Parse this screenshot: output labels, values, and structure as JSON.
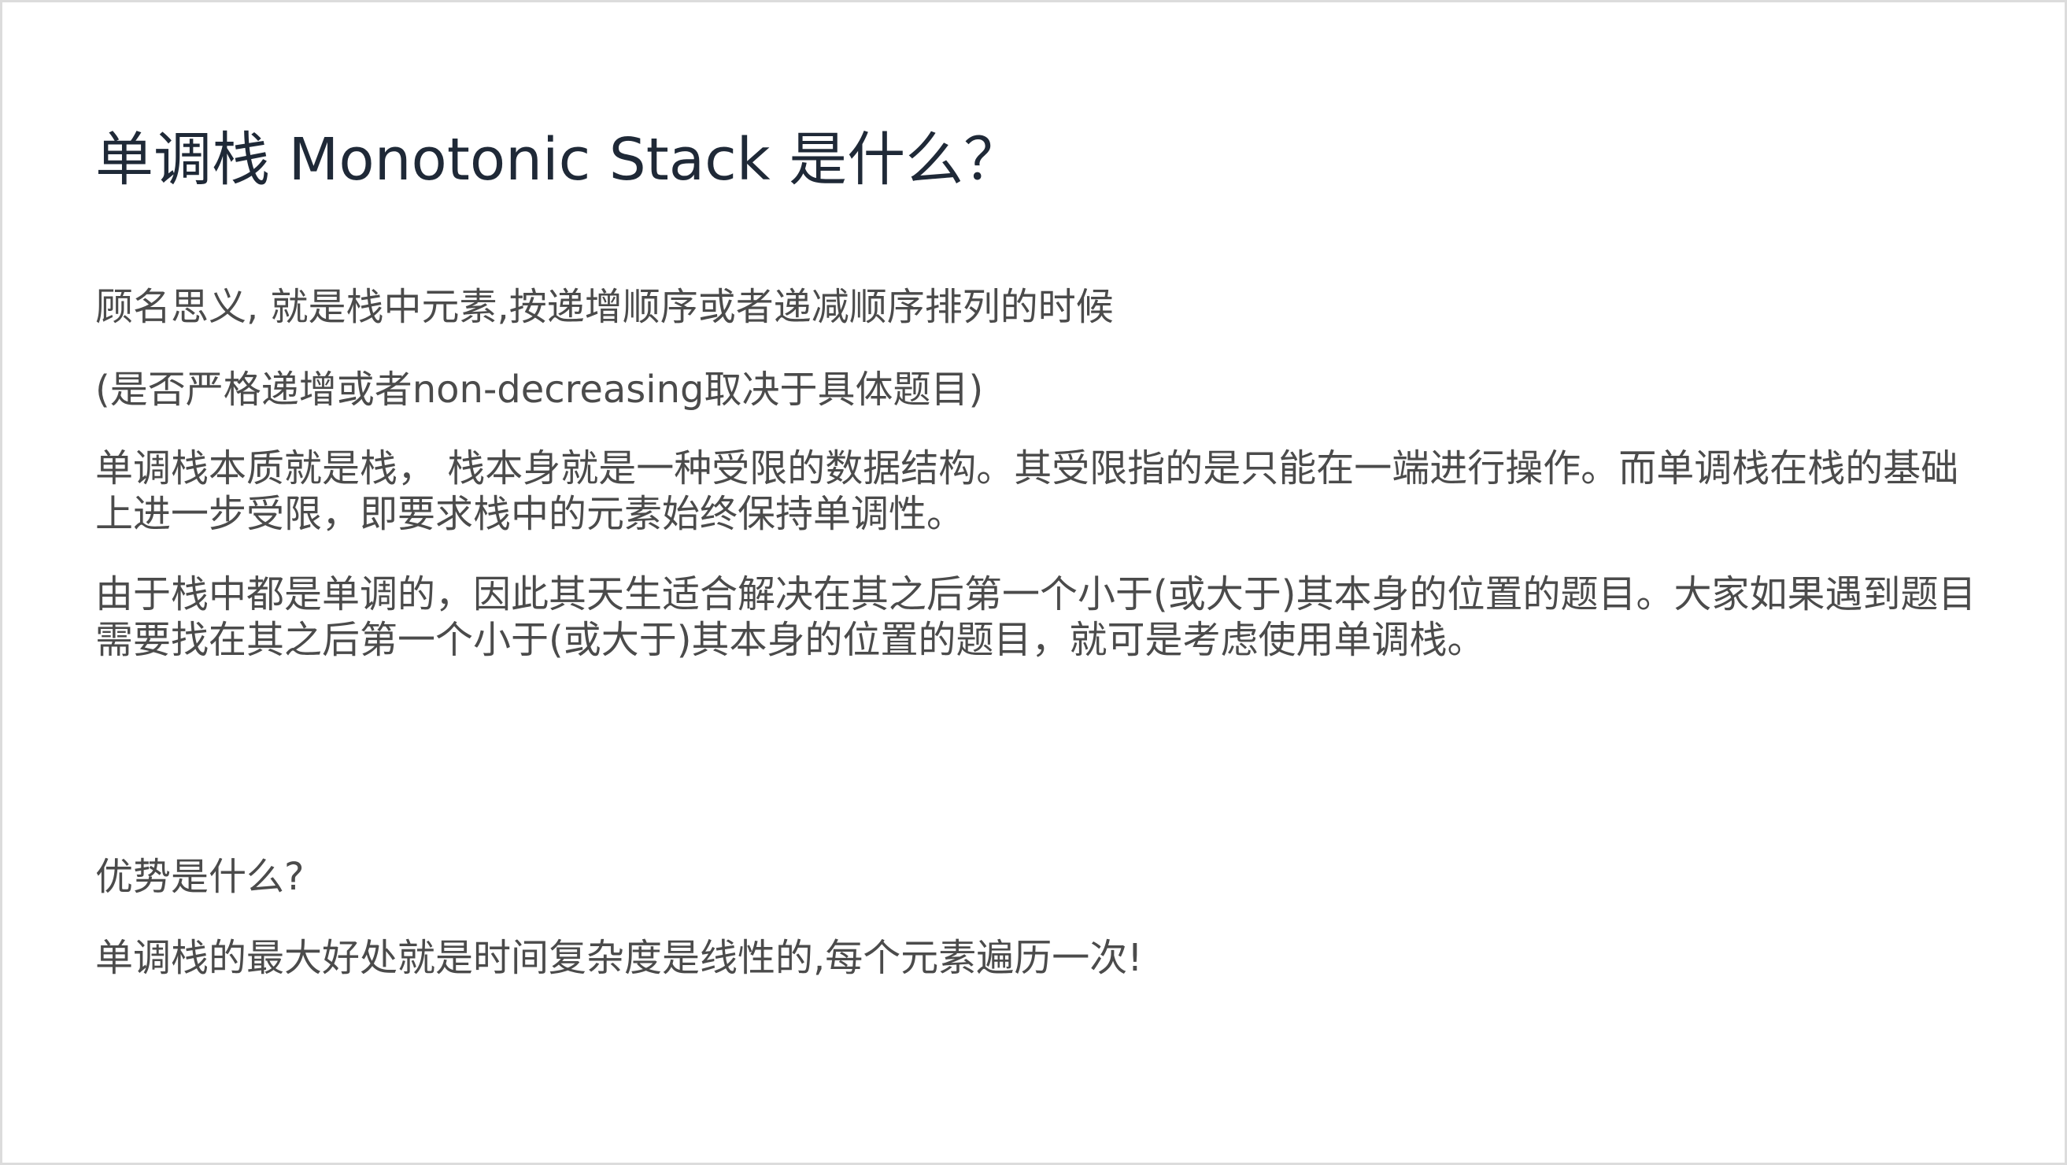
{
  "slide": {
    "title": "单调栈 Monotonic Stack 是什么？",
    "paragraphs": {
      "p1": "顾名思义, 就是栈中元素,按递增顺序或者递减顺序排列的时候",
      "p2": "(是否严格递增或者non-decreasing取决于具体题目)",
      "p3": "单调栈本质就是栈， 栈本身就是一种受限的数据结构。其受限指的是只能在一端进行操作。而单调栈在栈的基础上进一步受限，即要求栈中的元素始终保持单调性。",
      "p4": "由于栈中都是单调的，因此其天生适合解决在其之后第一个小于(或大于)其本身的位置的题目。大家如果遇到题目需要找在其之后第一个小于(或大于)其本身的位置的题目，就可是考虑使用单调栈。",
      "p5": "优势是什么?",
      "p6": "单调栈的最大好处就是时间复杂度是线性的,每个元素遍历一次!"
    }
  },
  "colors": {
    "title": "#1f2937",
    "body_text": "#4b4b4b",
    "border": "#dcdcdc",
    "background": "#ffffff"
  }
}
